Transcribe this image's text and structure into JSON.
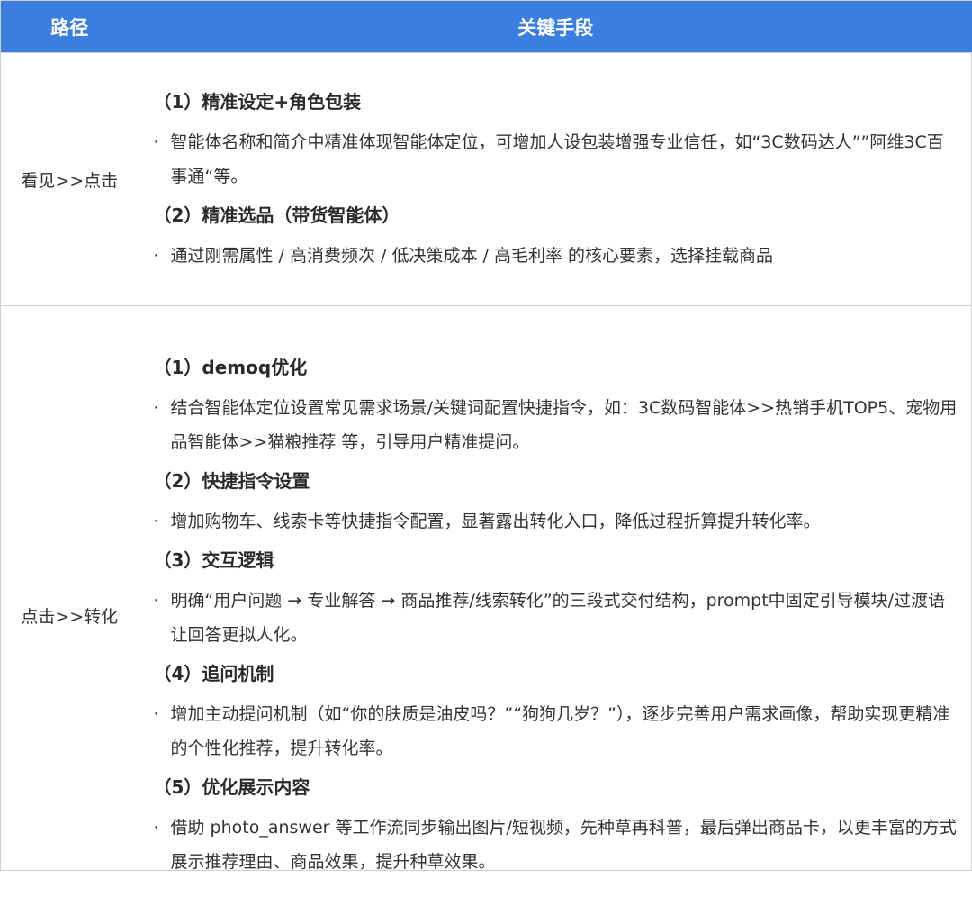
{
  "header": {
    "col1": "路径",
    "col2": "关键手段"
  },
  "rows": [
    {
      "path": "看见>>点击",
      "sections": [
        {
          "title": "（1）精准设定+角色包装",
          "text": "智能体名称和简介中精准体现智能体定位，可增加人设包装增强专业信任，如“3C数码达人””阿维3C百事通“等。"
        },
        {
          "title": "（2）精准选品（带货智能体）",
          "text": "通过刚需属性 / 高消费频次 / 低决策成本 / 高毛利率 的核心要素，选择挂载商品"
        }
      ]
    },
    {
      "path": "点击>>转化",
      "sections": [
        {
          "title": "（1）demoq优化",
          "text": "结合智能体定位设置常见需求场景/关键词配置快捷指令，如：3C数码智能体>>热销手机TOP5、宠物用品智能体>>猫粮推荐 等，引导用户精准提问。"
        },
        {
          "title": "（2）快捷指令设置",
          "text": "增加购物车、线索卡等快捷指令配置，显著露出转化入口，降低过程折算提升转化率。"
        },
        {
          "title": "（3）交互逻辑",
          "text": "明确“用户问题 → 专业解答 → 商品推荐/线索转化”的三段式交付结构，prompt中固定引导模块/过渡语让回答更拟人化。"
        },
        {
          "title": "（4）追问机制",
          "text": "增加主动提问机制（如“你的肤质是油皮吗？”“狗狗几岁？”），逐步完善用户需求画像，帮助实现更精准的个性化推荐，提升转化率。"
        },
        {
          "title": "（5）优化展示内容",
          "text": "借助 photo_answer 等工作流同步输出图片/短视频，先种草再科普，最后弹出商品卡，以更丰富的方式展示推荐理由、商品效果，提升种草效果。"
        }
      ]
    }
  ],
  "bullet_mark": "·",
  "colors": {
    "header_bg": "#3a7ee0",
    "border": "#cfcfcf",
    "text": "#333333"
  }
}
